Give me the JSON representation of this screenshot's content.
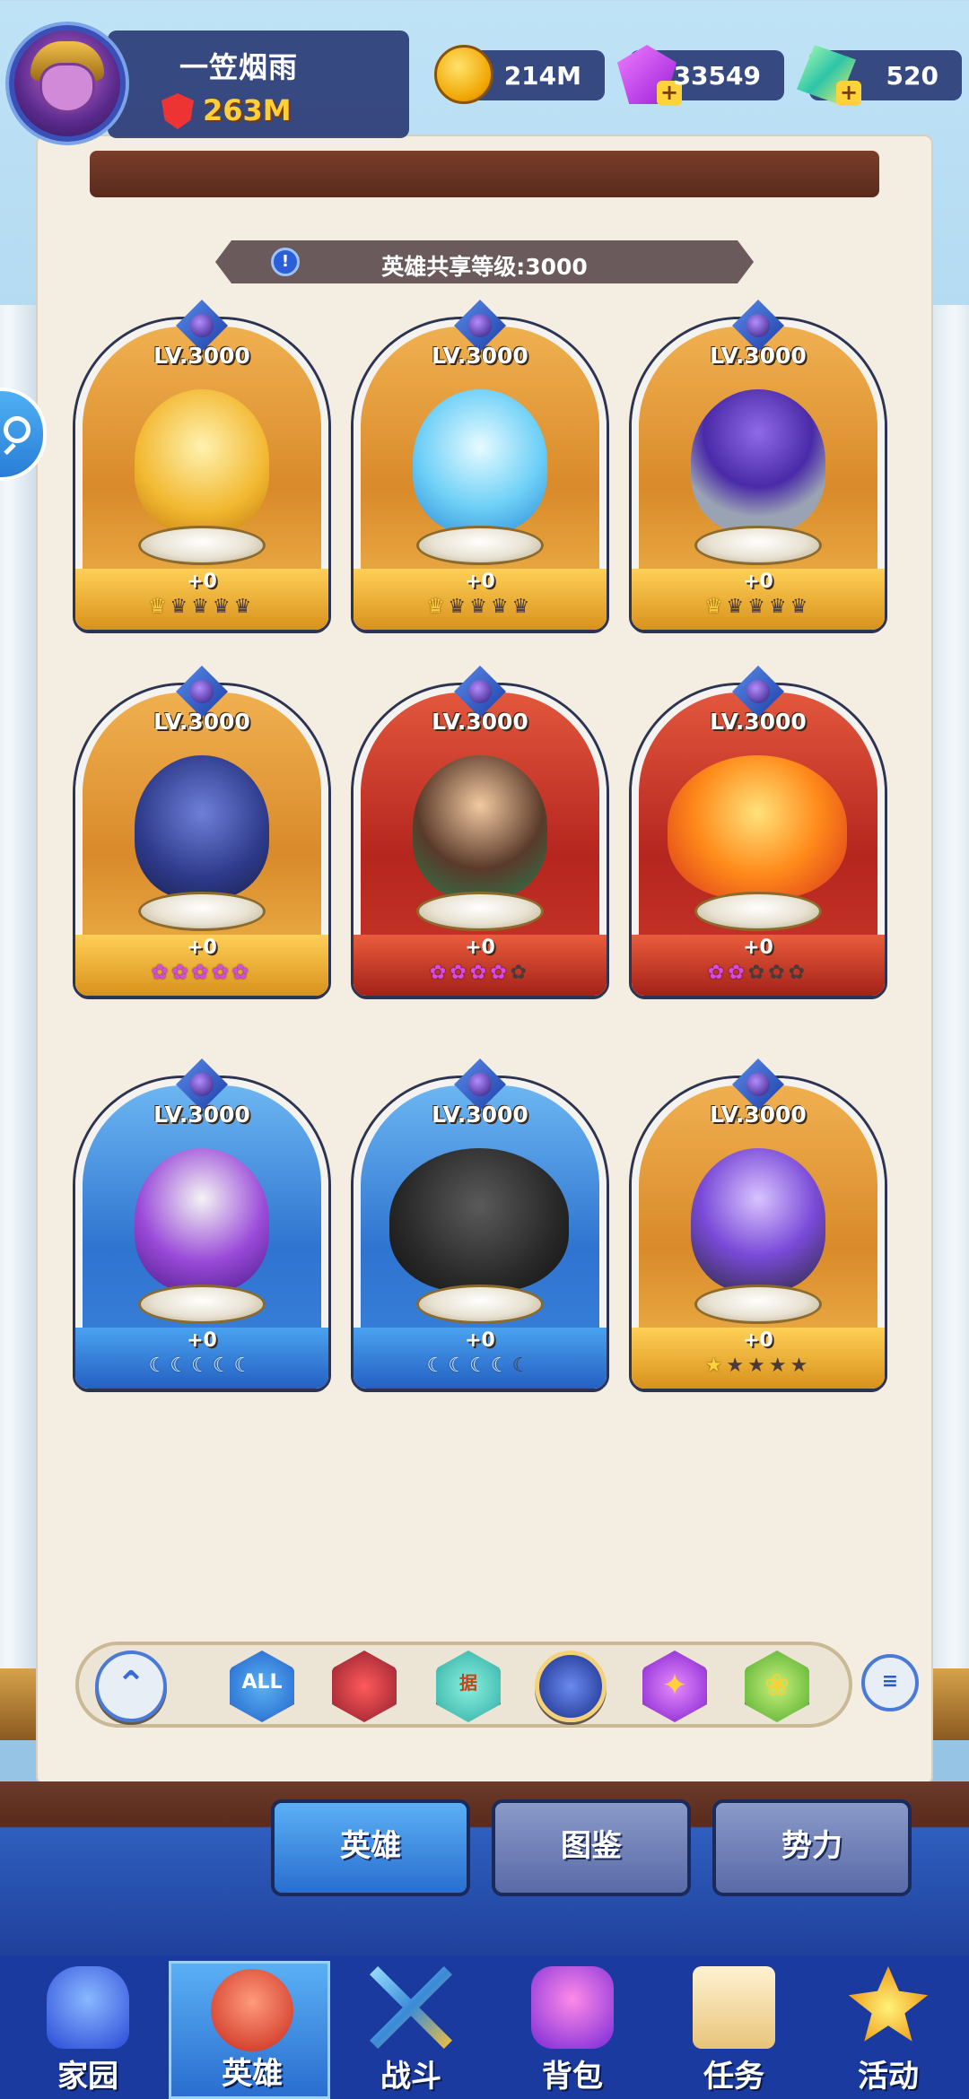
{
  "player": {
    "name": "一笠烟雨",
    "power": "263M"
  },
  "currencies": [
    {
      "name": "gold",
      "amount": "214M"
    },
    {
      "name": "purple-gem",
      "amount": "33549"
    },
    {
      "name": "green-crystal",
      "amount": "520"
    }
  ],
  "banner": {
    "icon_glyph": "!",
    "text": "英雄共享等级:3000"
  },
  "heroes": [
    {
      "level": "LV.3000",
      "plus": "+0",
      "theme": "gold",
      "figure": "golden-warrior",
      "stars": {
        "type": "crown",
        "on": 1,
        "total": 5
      }
    },
    {
      "level": "LV.3000",
      "plus": "+0",
      "theme": "gold",
      "figure": "ice-spirit",
      "stars": {
        "type": "crown",
        "on": 1,
        "total": 5
      }
    },
    {
      "level": "LV.3000",
      "plus": "+0",
      "theme": "gold",
      "figure": "wizard",
      "stars": {
        "type": "crown",
        "on": 1,
        "total": 5
      }
    },
    {
      "level": "LV.3000",
      "plus": "+0",
      "theme": "gold",
      "figure": "dark-dragon",
      "stars": {
        "type": "purple",
        "on": 5,
        "total": 5
      }
    },
    {
      "level": "LV.3000",
      "plus": "+0",
      "theme": "red",
      "figure": "medusa-archer",
      "stars": {
        "type": "purple",
        "on": 4,
        "total": 5
      }
    },
    {
      "level": "LV.3000",
      "plus": "+0",
      "theme": "red",
      "figure": "fire-phoenix",
      "stars": {
        "type": "purple",
        "on": 2,
        "total": 5
      }
    },
    {
      "level": "LV.3000",
      "plus": "+0",
      "theme": "blue",
      "figure": "genie",
      "stars": {
        "type": "moon",
        "on": 5,
        "total": 5
      }
    },
    {
      "level": "LV.3000",
      "plus": "+0",
      "theme": "blue",
      "figure": "golem",
      "stars": {
        "type": "moon",
        "on": 4,
        "total": 5
      }
    },
    {
      "level": "LV.3000",
      "plus": "+0",
      "theme": "gold",
      "figure": "ninja",
      "stars": {
        "type": "star",
        "on": 1,
        "total": 5
      }
    }
  ],
  "filters": [
    {
      "id": "up",
      "glyph": "⌃"
    },
    {
      "id": "all",
      "glyph": "ALL"
    },
    {
      "id": "dark",
      "glyph": ""
    },
    {
      "id": "ground",
      "glyph": "据"
    },
    {
      "id": "orb",
      "glyph": ""
    },
    {
      "id": "light",
      "glyph": "✦"
    },
    {
      "id": "nature",
      "glyph": "❀"
    }
  ],
  "sort_button": {
    "glyph": "≡"
  },
  "tabs": [
    {
      "label": "英雄",
      "active": true
    },
    {
      "label": "图鉴",
      "active": false
    },
    {
      "label": "势力",
      "active": false
    }
  ],
  "nav": [
    {
      "label": "家园",
      "icon": "home-icon",
      "active": false
    },
    {
      "label": "英雄",
      "icon": "hero-icon",
      "active": true
    },
    {
      "label": "战斗",
      "icon": "battle-icon",
      "active": false
    },
    {
      "label": "背包",
      "icon": "bag-icon",
      "active": false
    },
    {
      "label": "任务",
      "icon": "task-icon",
      "active": false
    },
    {
      "label": "活动",
      "icon": "event-icon",
      "active": false
    }
  ]
}
